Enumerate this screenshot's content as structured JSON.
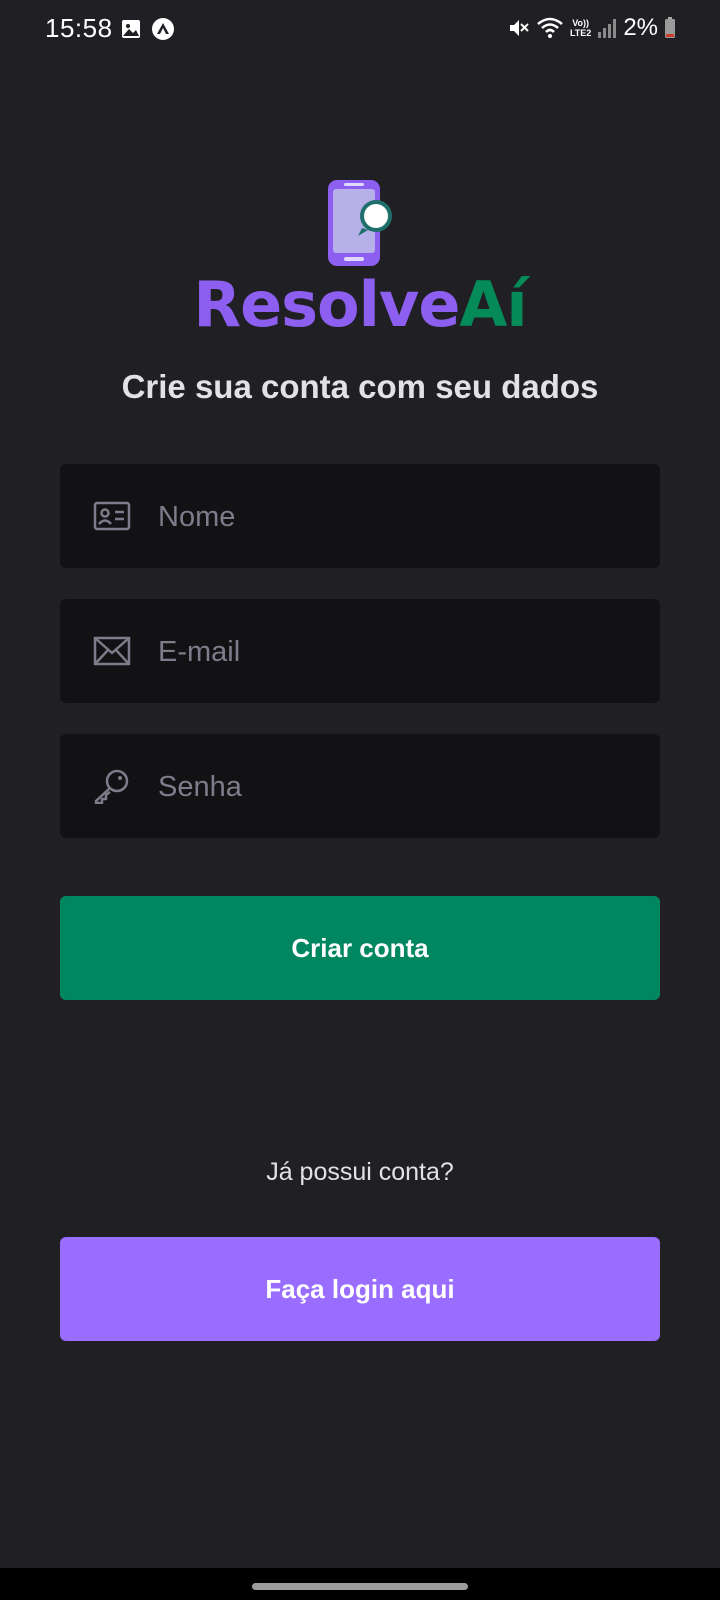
{
  "status_bar": {
    "time": "15:58",
    "network_label_top": "Vo))",
    "network_label_bottom": "LTE2",
    "battery": "2%"
  },
  "brand": {
    "name_part1": "Resolve",
    "name_part2": "Aí",
    "primary_color": "#8d5ff1",
    "accent_color": "#058b59"
  },
  "headline": "Crie sua conta com seu dados",
  "form": {
    "name_placeholder": "Nome",
    "name_value": "",
    "email_placeholder": "E-mail",
    "email_value": "",
    "password_placeholder": "Senha",
    "password_value": ""
  },
  "create_button_label": "Criar conta",
  "login_prompt": "Já possui conta?",
  "login_button_label": "Faça login aqui",
  "icons": {
    "name_field": "id-card-icon",
    "email_field": "envelope-icon",
    "password_field": "key-icon"
  },
  "colors": {
    "background": "#202024",
    "input_background": "#121214",
    "create_button": "#00875f",
    "login_button": "#996dff"
  }
}
